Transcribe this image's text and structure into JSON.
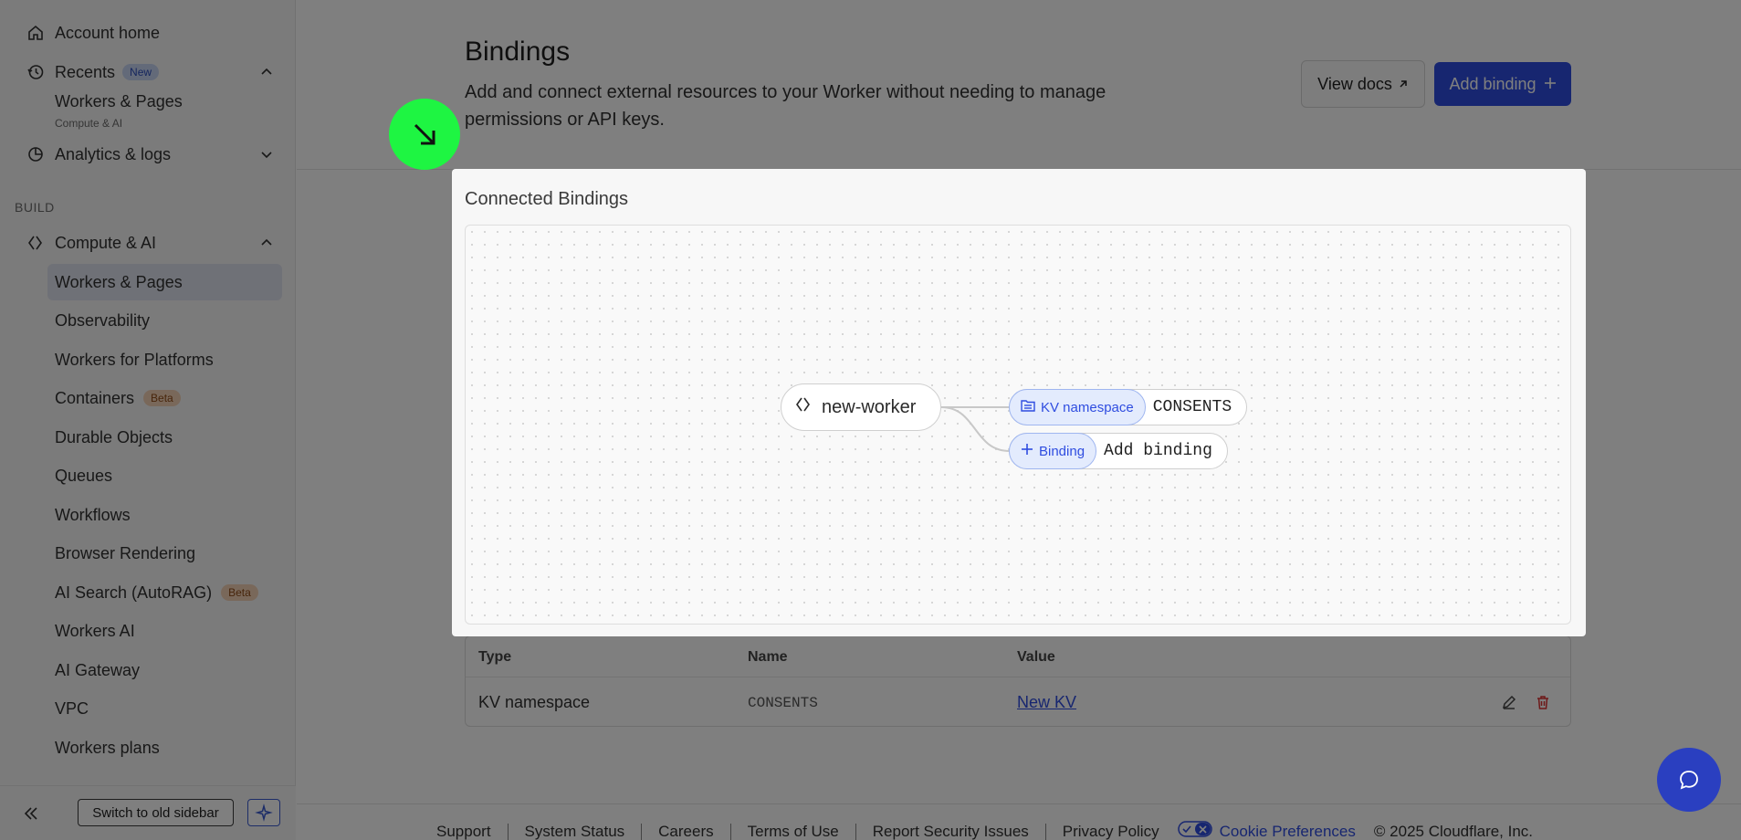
{
  "sidebar": {
    "account_home": "Account home",
    "recents_label": "Recents",
    "recents_badge": "New",
    "recent_item": "Workers & Pages",
    "recent_item_sub": "Compute & AI",
    "analytics": "Analytics & logs",
    "section_build": "BUILD",
    "compute_ai": "Compute & AI",
    "items": [
      {
        "label": "Workers & Pages",
        "badge": "",
        "active": true
      },
      {
        "label": "Observability",
        "badge": ""
      },
      {
        "label": "Workers for Platforms",
        "badge": ""
      },
      {
        "label": "Containers",
        "badge": "Beta"
      },
      {
        "label": "Durable Objects",
        "badge": ""
      },
      {
        "label": "Queues",
        "badge": ""
      },
      {
        "label": "Workflows",
        "badge": ""
      },
      {
        "label": "Browser Rendering",
        "badge": ""
      },
      {
        "label": "AI Search (AutoRAG)",
        "badge": "Beta"
      },
      {
        "label": "Workers AI",
        "badge": ""
      },
      {
        "label": "AI Gateway",
        "badge": ""
      },
      {
        "label": "VPC",
        "badge": ""
      },
      {
        "label": "Workers plans",
        "badge": ""
      }
    ],
    "switch_old": "Switch to old sidebar"
  },
  "header": {
    "title": "Bindings",
    "description": "Add and connect external resources to your Worker without needing to manage permissions or API keys.",
    "view_docs": "View docs",
    "add_binding": "Add binding"
  },
  "modal": {
    "title": "Connected Bindings",
    "worker_name": "new-worker",
    "bindings": [
      {
        "tag": "KV namespace",
        "value": "CONSENTS"
      },
      {
        "tag": "Binding",
        "value": "Add binding"
      }
    ]
  },
  "table": {
    "headers": [
      "Type",
      "Name",
      "Value"
    ],
    "rows": [
      {
        "type": "KV namespace",
        "name": "CONSENTS",
        "value": "New KV"
      }
    ]
  },
  "footer": {
    "links": [
      "Support",
      "System Status",
      "Careers",
      "Terms of Use",
      "Report Security Issues",
      "Privacy Policy"
    ],
    "cookie": "Cookie Preferences",
    "copyright": "© 2025 Cloudflare, Inc."
  },
  "colors": {
    "accent": "#2f4de0",
    "cursor": "#1ef542",
    "overlay": "rgba(0,0,0,0.5)"
  },
  "icons": [
    "home-icon",
    "history-icon",
    "analytics-icon",
    "compute-icon",
    "collapse-icon",
    "sparkle-icon",
    "arrow-up-right-icon",
    "plus-icon",
    "folder-icon",
    "edit-icon",
    "trash-icon",
    "chat-icon",
    "cursor-arrow-icon"
  ]
}
